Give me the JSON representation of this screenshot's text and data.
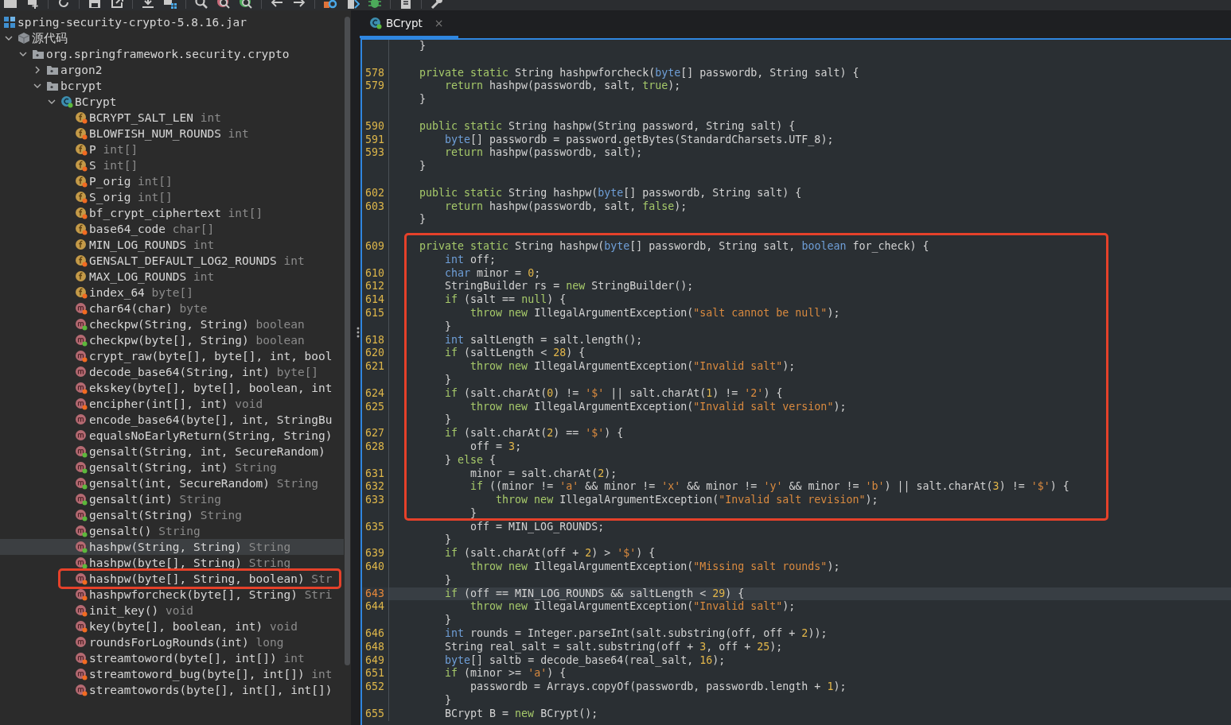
{
  "tree": {
    "kind": "jar",
    "label": "spring-security-crypto-5.8.16.jar",
    "selected": false,
    "children": [
      {
        "kind": "source",
        "label": "源代码",
        "expanded": true,
        "selected": false,
        "children": [
          {
            "kind": "package",
            "label": "org.springframework.security.crypto",
            "expanded": true,
            "selected": false,
            "children": [
              {
                "kind": "package",
                "label": "argon2",
                "expanded": false,
                "selected": false
              },
              {
                "kind": "package",
                "label": "bcrypt",
                "expanded": true,
                "selected": false,
                "children": [
                  {
                    "kind": "class",
                    "label": "BCrypt",
                    "expanded": true,
                    "selected": false,
                    "children": [
                      {
                        "kind": "field",
                        "label": "BCRYPT_SALT_LEN",
                        "type": "int",
                        "color": "#f26b21",
                        "selected": false
                      },
                      {
                        "kind": "field",
                        "label": "BLOWFISH_NUM_ROUNDS",
                        "type": "int",
                        "color": "#f26b21",
                        "selected": false
                      },
                      {
                        "kind": "field",
                        "label": "P",
                        "type": "int[]",
                        "color": "#f26b21",
                        "selected": false
                      },
                      {
                        "kind": "field",
                        "label": "S",
                        "type": "int[]",
                        "color": "#f26b21",
                        "selected": false
                      },
                      {
                        "kind": "field",
                        "label": "P_orig",
                        "type": "int[]",
                        "color": "#f26b21",
                        "selected": false
                      },
                      {
                        "kind": "field",
                        "label": "S_orig",
                        "type": "int[]",
                        "color": "#f26b21",
                        "selected": false
                      },
                      {
                        "kind": "field",
                        "label": "bf_crypt_ciphertext",
                        "type": "int[]",
                        "color": "#f26b21",
                        "selected": false
                      },
                      {
                        "kind": "field",
                        "label": "base64_code",
                        "type": "char[]",
                        "color": "#f26b21",
                        "selected": false
                      },
                      {
                        "kind": "field",
                        "label": "MIN_LOG_ROUNDS",
                        "type": "int",
                        "selected": false
                      },
                      {
                        "kind": "field",
                        "label": "GENSALT_DEFAULT_LOG2_ROUNDS",
                        "type": "int",
                        "color": "#f26b21",
                        "selected": false
                      },
                      {
                        "kind": "field",
                        "label": "MAX_LOG_ROUNDS",
                        "type": "int",
                        "selected": false
                      },
                      {
                        "kind": "field",
                        "label": "index_64",
                        "type": "byte[]",
                        "color": "#f26b21",
                        "selected": false
                      },
                      {
                        "kind": "method",
                        "label": "char64(char)",
                        "type": "byte",
                        "color": "#f26b21",
                        "selected": false
                      },
                      {
                        "kind": "method",
                        "label": "checkpw(String, String)",
                        "type": "boolean",
                        "color": "#5cb83c",
                        "selected": false
                      },
                      {
                        "kind": "method",
                        "label": "checkpw(byte[], String)",
                        "type": "boolean",
                        "color": "#5cb83c",
                        "selected": false
                      },
                      {
                        "kind": "method",
                        "label": "crypt_raw(byte[], byte[], int, bool",
                        "color": "#f26b21",
                        "selected": false
                      },
                      {
                        "kind": "method",
                        "label": "decode_base64(String, int)",
                        "type": "byte[]",
                        "selected": false
                      },
                      {
                        "kind": "method",
                        "label": "ekskey(byte[], byte[], boolean, int",
                        "color": "#f26b21",
                        "selected": false
                      },
                      {
                        "kind": "method",
                        "label": "encipher(int[], int)",
                        "type": "void",
                        "color": "#f26b21",
                        "selected": false
                      },
                      {
                        "kind": "method",
                        "label": "encode_base64(byte[], int, StringBu",
                        "selected": false
                      },
                      {
                        "kind": "method",
                        "label": "equalsNoEarlyReturn(String, String)",
                        "selected": false
                      },
                      {
                        "kind": "method",
                        "label": "gensalt(String, int, SecureRandom)",
                        "color": "#5cb83c",
                        "selected": false
                      },
                      {
                        "kind": "method",
                        "label": "gensalt(String, int)",
                        "type": "String",
                        "color": "#5cb83c",
                        "selected": false
                      },
                      {
                        "kind": "method",
                        "label": "gensalt(int, SecureRandom)",
                        "type": "String",
                        "color": "#5cb83c",
                        "selected": false
                      },
                      {
                        "kind": "method",
                        "label": "gensalt(int)",
                        "type": "String",
                        "color": "#5cb83c",
                        "selected": false
                      },
                      {
                        "kind": "method",
                        "label": "gensalt(String)",
                        "type": "String",
                        "color": "#5cb83c",
                        "selected": false
                      },
                      {
                        "kind": "method",
                        "label": "gensalt()",
                        "type": "String",
                        "color": "#5cb83c",
                        "selected": false
                      },
                      {
                        "kind": "method",
                        "label": "hashpw(String, String)",
                        "type": "String",
                        "color": "#5cb83c",
                        "selected": true
                      },
                      {
                        "kind": "method",
                        "label": "hashpw(byte[], String)",
                        "type": "String",
                        "color": "#5cb83c",
                        "selected": false
                      },
                      {
                        "kind": "method",
                        "label": "hashpw(byte[], String, boolean)",
                        "type": "Str",
                        "color": "#f26b21",
                        "selected": false,
                        "annotated": true
                      },
                      {
                        "kind": "method",
                        "label": "hashpwforcheck(byte[], String)",
                        "type": "Stri",
                        "color": "#f26b21",
                        "selected": false
                      },
                      {
                        "kind": "method",
                        "label": "init_key()",
                        "type": "void",
                        "color": "#f26b21",
                        "selected": false
                      },
                      {
                        "kind": "method",
                        "label": "key(byte[], boolean, int)",
                        "type": "void",
                        "color": "#f26b21",
                        "selected": false
                      },
                      {
                        "kind": "method",
                        "label": "roundsForLogRounds(int)",
                        "type": "long",
                        "selected": false
                      },
                      {
                        "kind": "method",
                        "label": "streamtoword(byte[], int[])",
                        "type": "int",
                        "color": "#f26b21",
                        "selected": false
                      },
                      {
                        "kind": "method",
                        "label": "streamtoword_bug(byte[], int[])",
                        "type": "int",
                        "color": "#f26b21",
                        "selected": false
                      },
                      {
                        "kind": "method",
                        "label": "streamtowords(byte[], int[], int[])",
                        "color": "#f26b21",
                        "selected": false
                      }
                    ]
                  }
                ]
              }
            ]
          }
        ]
      }
    ]
  },
  "editor": {
    "tabs": [
      {
        "label": "BCrypt",
        "close": "×",
        "selected": true
      }
    ],
    "blocks": [
      {
        "boxed": false,
        "lines": [
          {
            "current": false,
            "code": [
              {
                "kind": "plain",
                "text": "    }"
              }
            ]
          },
          {
            "current": false
          },
          {
            "number": "578",
            "current": false,
            "code": [
              {
                "kind": "keyword",
                "text": "    private static"
              },
              {
                "kind": "plain",
                "text": " String hashpwforcheck("
              },
              {
                "kind": "type",
                "text": "byte"
              },
              {
                "kind": "plain",
                "text": "[] passwordb, String salt) {"
              }
            ]
          },
          {
            "number": "579",
            "current": false,
            "code": [
              {
                "kind": "keyword",
                "text": "        return"
              },
              {
                "kind": "plain",
                "text": " hashpw(passwordb, salt, "
              },
              {
                "kind": "keyword",
                "text": "true"
              },
              {
                "kind": "plain",
                "text": ");"
              }
            ]
          },
          {
            "current": false,
            "code": [
              {
                "kind": "plain",
                "text": "    }"
              }
            ]
          },
          {
            "current": false
          },
          {
            "number": "590",
            "current": false,
            "code": [
              {
                "kind": "keyword",
                "text": "    public static"
              },
              {
                "kind": "plain",
                "text": " String hashpw(String password, String salt) {"
              }
            ]
          },
          {
            "number": "591",
            "current": false,
            "code": [
              {
                "kind": "type",
                "text": "        byte"
              },
              {
                "kind": "plain",
                "text": "[] passwordb = password.getBytes(StandardCharsets.UTF_8);"
              }
            ]
          },
          {
            "number": "593",
            "current": false,
            "code": [
              {
                "kind": "keyword",
                "text": "        return"
              },
              {
                "kind": "plain",
                "text": " hashpw(passwordb, salt);"
              }
            ]
          },
          {
            "current": false,
            "code": [
              {
                "kind": "plain",
                "text": "    }"
              }
            ]
          },
          {
            "current": false
          },
          {
            "number": "602",
            "current": false,
            "code": [
              {
                "kind": "keyword",
                "text": "    public static"
              },
              {
                "kind": "plain",
                "text": " String hashpw("
              },
              {
                "kind": "type",
                "text": "byte"
              },
              {
                "kind": "plain",
                "text": "[] passwordb, String salt) {"
              }
            ]
          },
          {
            "number": "603",
            "current": false,
            "code": [
              {
                "kind": "keyword",
                "text": "        return"
              },
              {
                "kind": "plain",
                "text": " hashpw(passwordb, salt, "
              },
              {
                "kind": "keyword",
                "text": "false"
              },
              {
                "kind": "plain",
                "text": ");"
              }
            ]
          },
          {
            "current": false,
            "code": [
              {
                "kind": "plain",
                "text": "    }"
              }
            ]
          },
          {
            "current": false
          }
        ]
      },
      {
        "boxed": true,
        "lines": [
          {
            "number": "609",
            "current": false,
            "code": [
              {
                "kind": "keyword",
                "text": "    private static"
              },
              {
                "kind": "plain",
                "text": " String hashpw("
              },
              {
                "kind": "type",
                "text": "byte"
              },
              {
                "kind": "plain",
                "text": "[] passwordb, String salt, "
              },
              {
                "kind": "type",
                "text": "boolean"
              },
              {
                "kind": "plain",
                "text": " for_check) {"
              }
            ]
          },
          {
            "current": false,
            "code": [
              {
                "kind": "type",
                "text": "        int"
              },
              {
                "kind": "plain",
                "text": " off;"
              }
            ]
          },
          {
            "number": "610",
            "current": false,
            "code": [
              {
                "kind": "type",
                "text": "        char"
              },
              {
                "kind": "plain",
                "text": " minor = "
              },
              {
                "kind": "number",
                "text": "0"
              },
              {
                "kind": "plain",
                "text": ";"
              }
            ]
          },
          {
            "number": "612",
            "current": false,
            "code": [
              {
                "kind": "plain",
                "text": "        StringBuilder rs = "
              },
              {
                "kind": "keyword",
                "text": "new"
              },
              {
                "kind": "plain",
                "text": " StringBuilder();"
              }
            ]
          },
          {
            "number": "614",
            "current": false,
            "code": [
              {
                "kind": "keyword",
                "text": "        if"
              },
              {
                "kind": "plain",
                "text": " (salt == "
              },
              {
                "kind": "keyword",
                "text": "null"
              },
              {
                "kind": "plain",
                "text": ") {"
              }
            ]
          },
          {
            "number": "615",
            "current": false,
            "code": [
              {
                "kind": "keyword",
                "text": "            throw new"
              },
              {
                "kind": "plain",
                "text": " IllegalArgumentException("
              },
              {
                "kind": "string",
                "text": "\"salt cannot be null\""
              },
              {
                "kind": "plain",
                "text": ");"
              }
            ]
          },
          {
            "current": false,
            "code": [
              {
                "kind": "plain",
                "text": "        }"
              }
            ]
          },
          {
            "number": "618",
            "current": false,
            "code": [
              {
                "kind": "type",
                "text": "        int"
              },
              {
                "kind": "plain",
                "text": " saltLength = salt.length();"
              }
            ]
          },
          {
            "number": "620",
            "current": false,
            "code": [
              {
                "kind": "keyword",
                "text": "        if"
              },
              {
                "kind": "plain",
                "text": " (saltLength < "
              },
              {
                "kind": "number",
                "text": "28"
              },
              {
                "kind": "plain",
                "text": ") {"
              }
            ]
          },
          {
            "number": "621",
            "current": false,
            "code": [
              {
                "kind": "keyword",
                "text": "            throw new"
              },
              {
                "kind": "plain",
                "text": " IllegalArgumentException("
              },
              {
                "kind": "string",
                "text": "\"Invalid salt\""
              },
              {
                "kind": "plain",
                "text": ");"
              }
            ]
          },
          {
            "current": false,
            "code": [
              {
                "kind": "plain",
                "text": "        }"
              }
            ]
          },
          {
            "number": "624",
            "current": false,
            "code": [
              {
                "kind": "keyword",
                "text": "        if"
              },
              {
                "kind": "plain",
                "text": " (salt.charAt("
              },
              {
                "kind": "number",
                "text": "0"
              },
              {
                "kind": "plain",
                "text": ") != "
              },
              {
                "kind": "string",
                "text": "'$'"
              },
              {
                "kind": "plain",
                "text": " || salt.charAt("
              },
              {
                "kind": "number",
                "text": "1"
              },
              {
                "kind": "plain",
                "text": ") != "
              },
              {
                "kind": "string",
                "text": "'2'"
              },
              {
                "kind": "plain",
                "text": ") {"
              }
            ]
          },
          {
            "number": "625",
            "current": false,
            "code": [
              {
                "kind": "keyword",
                "text": "            throw new"
              },
              {
                "kind": "plain",
                "text": " IllegalArgumentException("
              },
              {
                "kind": "string",
                "text": "\"Invalid salt version\""
              },
              {
                "kind": "plain",
                "text": ");"
              }
            ]
          },
          {
            "current": false,
            "code": [
              {
                "kind": "plain",
                "text": "        }"
              }
            ]
          },
          {
            "number": "627",
            "current": false,
            "code": [
              {
                "kind": "keyword",
                "text": "        if"
              },
              {
                "kind": "plain",
                "text": " (salt.charAt("
              },
              {
                "kind": "number",
                "text": "2"
              },
              {
                "kind": "plain",
                "text": ") == "
              },
              {
                "kind": "string",
                "text": "'$'"
              },
              {
                "kind": "plain",
                "text": ") {"
              }
            ]
          },
          {
            "number": "628",
            "current": false,
            "code": [
              {
                "kind": "plain",
                "text": "            off = "
              },
              {
                "kind": "number",
                "text": "3"
              },
              {
                "kind": "plain",
                "text": ";"
              }
            ]
          },
          {
            "current": false,
            "code": [
              {
                "kind": "plain",
                "text": "        } "
              },
              {
                "kind": "keyword",
                "text": "else"
              },
              {
                "kind": "plain",
                "text": " {"
              }
            ]
          },
          {
            "number": "631",
            "current": false,
            "code": [
              {
                "kind": "plain",
                "text": "            minor = salt.charAt("
              },
              {
                "kind": "number",
                "text": "2"
              },
              {
                "kind": "plain",
                "text": ");"
              }
            ]
          },
          {
            "number": "632",
            "current": false,
            "code": [
              {
                "kind": "keyword",
                "text": "            if"
              },
              {
                "kind": "plain",
                "text": " ((minor != "
              },
              {
                "kind": "string",
                "text": "'a'"
              },
              {
                "kind": "plain",
                "text": " && minor != "
              },
              {
                "kind": "string",
                "text": "'x'"
              },
              {
                "kind": "plain",
                "text": " && minor != "
              },
              {
                "kind": "string",
                "text": "'y'"
              },
              {
                "kind": "plain",
                "text": " && minor != "
              },
              {
                "kind": "string",
                "text": "'b'"
              },
              {
                "kind": "plain",
                "text": ") || salt.charAt("
              },
              {
                "kind": "number",
                "text": "3"
              },
              {
                "kind": "plain",
                "text": ") != "
              },
              {
                "kind": "string",
                "text": "'$'"
              },
              {
                "kind": "plain",
                "text": ") {"
              }
            ]
          },
          {
            "number": "633",
            "current": false,
            "code": [
              {
                "kind": "keyword",
                "text": "                throw new"
              },
              {
                "kind": "plain",
                "text": " IllegalArgumentException("
              },
              {
                "kind": "string",
                "text": "\"Invalid salt revision\""
              },
              {
                "kind": "plain",
                "text": ");"
              }
            ]
          },
          {
            "current": false,
            "code": [
              {
                "kind": "plain",
                "text": "            }"
              }
            ]
          }
        ]
      },
      {
        "boxed": false,
        "lines": [
          {
            "number": "635",
            "current": false,
            "code": [
              {
                "kind": "plain",
                "text": "            off = MIN_LOG_ROUNDS;"
              }
            ]
          },
          {
            "current": false,
            "code": [
              {
                "kind": "plain",
                "text": "        }"
              }
            ]
          },
          {
            "number": "639",
            "current": false,
            "code": [
              {
                "kind": "keyword",
                "text": "        if"
              },
              {
                "kind": "plain",
                "text": " (salt.charAt(off + "
              },
              {
                "kind": "number",
                "text": "2"
              },
              {
                "kind": "plain",
                "text": ") > "
              },
              {
                "kind": "string",
                "text": "'$'"
              },
              {
                "kind": "plain",
                "text": ") {"
              }
            ]
          },
          {
            "number": "640",
            "current": false,
            "code": [
              {
                "kind": "keyword",
                "text": "            throw new"
              },
              {
                "kind": "plain",
                "text": " IllegalArgumentException("
              },
              {
                "kind": "string",
                "text": "\"Missing salt rounds\""
              },
              {
                "kind": "plain",
                "text": ");"
              }
            ]
          },
          {
            "current": false,
            "code": [
              {
                "kind": "plain",
                "text": "        }"
              }
            ]
          },
          {
            "number": "643",
            "current": true,
            "code": [
              {
                "kind": "keyword",
                "text": "        if"
              },
              {
                "kind": "plain",
                "text": " (off == MIN_LOG_ROUNDS && saltLength < "
              },
              {
                "kind": "number",
                "text": "29"
              },
              {
                "kind": "plain",
                "text": ") {"
              }
            ]
          },
          {
            "number": "644",
            "current": false,
            "code": [
              {
                "kind": "keyword",
                "text": "            throw new"
              },
              {
                "kind": "plain",
                "text": " IllegalArgumentException("
              },
              {
                "kind": "string",
                "text": "\"Invalid salt\""
              },
              {
                "kind": "plain",
                "text": ");"
              }
            ]
          },
          {
            "current": false,
            "code": [
              {
                "kind": "plain",
                "text": "        }"
              }
            ]
          },
          {
            "number": "646",
            "current": false,
            "code": [
              {
                "kind": "type",
                "text": "        int"
              },
              {
                "kind": "plain",
                "text": " rounds = Integer.parseInt(salt.substring(off, off + "
              },
              {
                "kind": "number",
                "text": "2"
              },
              {
                "kind": "plain",
                "text": "));"
              }
            ]
          },
          {
            "number": "648",
            "current": false,
            "code": [
              {
                "kind": "plain",
                "text": "        String real_salt = salt.substring(off + "
              },
              {
                "kind": "number",
                "text": "3"
              },
              {
                "kind": "plain",
                "text": ", off + "
              },
              {
                "kind": "number",
                "text": "25"
              },
              {
                "kind": "plain",
                "text": ");"
              }
            ]
          },
          {
            "number": "649",
            "current": false,
            "code": [
              {
                "kind": "type",
                "text": "        byte"
              },
              {
                "kind": "plain",
                "text": "[] saltb = decode_base64(real_salt, "
              },
              {
                "kind": "number",
                "text": "16"
              },
              {
                "kind": "plain",
                "text": ");"
              }
            ]
          },
          {
            "number": "651",
            "current": false,
            "code": [
              {
                "kind": "keyword",
                "text": "        if"
              },
              {
                "kind": "plain",
                "text": " (minor >= "
              },
              {
                "kind": "string",
                "text": "'a'"
              },
              {
                "kind": "plain",
                "text": ") {"
              }
            ]
          },
          {
            "number": "652",
            "current": false,
            "code": [
              {
                "kind": "plain",
                "text": "            passwordb = Arrays.copyOf(passwordb, passwordb.length + "
              },
              {
                "kind": "number",
                "text": "1"
              },
              {
                "kind": "plain",
                "text": ");"
              }
            ]
          },
          {
            "current": false,
            "code": [
              {
                "kind": "plain",
                "text": "        }"
              }
            ]
          },
          {
            "number": "655",
            "current": false,
            "code": [
              {
                "kind": "plain",
                "text": "        BCrypt B = "
              },
              {
                "kind": "keyword",
                "text": "new"
              },
              {
                "kind": "plain",
                "text": " BCrypt();"
              }
            ]
          }
        ]
      }
    ]
  }
}
